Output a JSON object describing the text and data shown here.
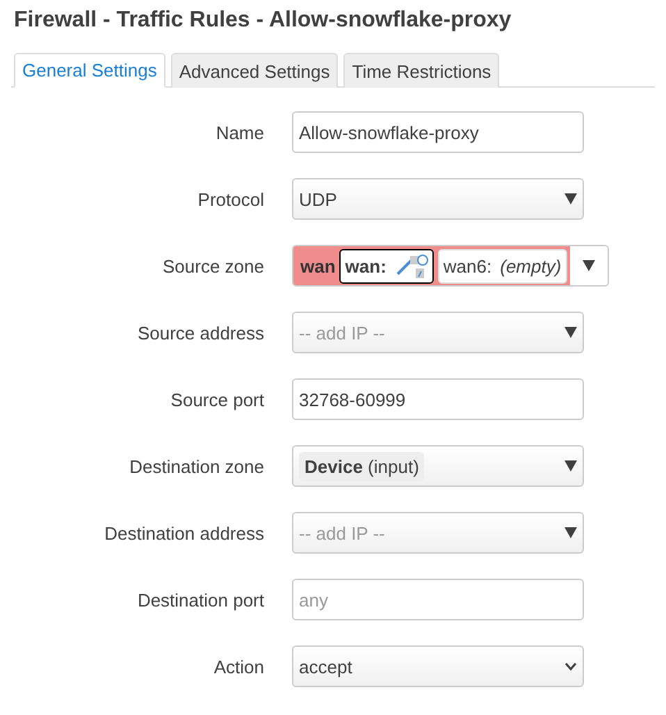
{
  "title": "Firewall - Traffic Rules - Allow-snowflake-proxy",
  "tabs": [
    {
      "label": "General Settings",
      "selected": true
    },
    {
      "label": "Advanced Settings",
      "selected": false
    },
    {
      "label": "Time Restrictions",
      "selected": false
    }
  ],
  "fields": [
    {
      "label": "Name",
      "kind": "text",
      "value": "Allow-snowflake-proxy"
    },
    {
      "label": "Protocol",
      "kind": "select",
      "value": "UDP"
    },
    {
      "label": "Source zone",
      "kind": "zone",
      "zone": "wan",
      "networks": [
        {
          "label": "wan:",
          "kind": "devices",
          "focused": true
        },
        {
          "label": "wan6:",
          "kind": "empty",
          "note": "(empty)",
          "focused": false
        }
      ]
    },
    {
      "label": "Source address",
      "kind": "dynlist",
      "placeholder": "-- add IP --"
    },
    {
      "label": "Source port",
      "kind": "text",
      "value": "32768-60999"
    },
    {
      "label": "Destination zone",
      "kind": "device",
      "name": "Device",
      "note": "(input)"
    },
    {
      "label": "Destination address",
      "kind": "dynlist",
      "placeholder": "-- add IP --"
    },
    {
      "label": "Destination port",
      "kind": "text",
      "placeholder": "any"
    },
    {
      "label": "Action",
      "kind": "native",
      "value": "accept"
    }
  ]
}
